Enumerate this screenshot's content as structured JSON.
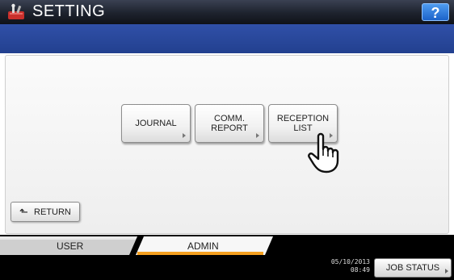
{
  "header": {
    "title": "SETTING",
    "help_label": "?",
    "icon": "setting-tools-icon"
  },
  "functions": [
    {
      "label": "JOURNAL"
    },
    {
      "label": "COMM.\nREPORT"
    },
    {
      "label": "RECEPTION\nLIST"
    }
  ],
  "return_button": {
    "label": "RETURN",
    "icon": "return-arrow-icon"
  },
  "tabs": [
    {
      "label": "USER",
      "selected": false
    },
    {
      "label": "ADMIN",
      "selected": true
    }
  ],
  "status": {
    "date": "05/10/2013",
    "time": "08:49"
  },
  "job_status_label": "JOB STATUS",
  "colors": {
    "accent": "#f5a020",
    "band": "#2a4aa0",
    "help": "#2a78e0"
  }
}
